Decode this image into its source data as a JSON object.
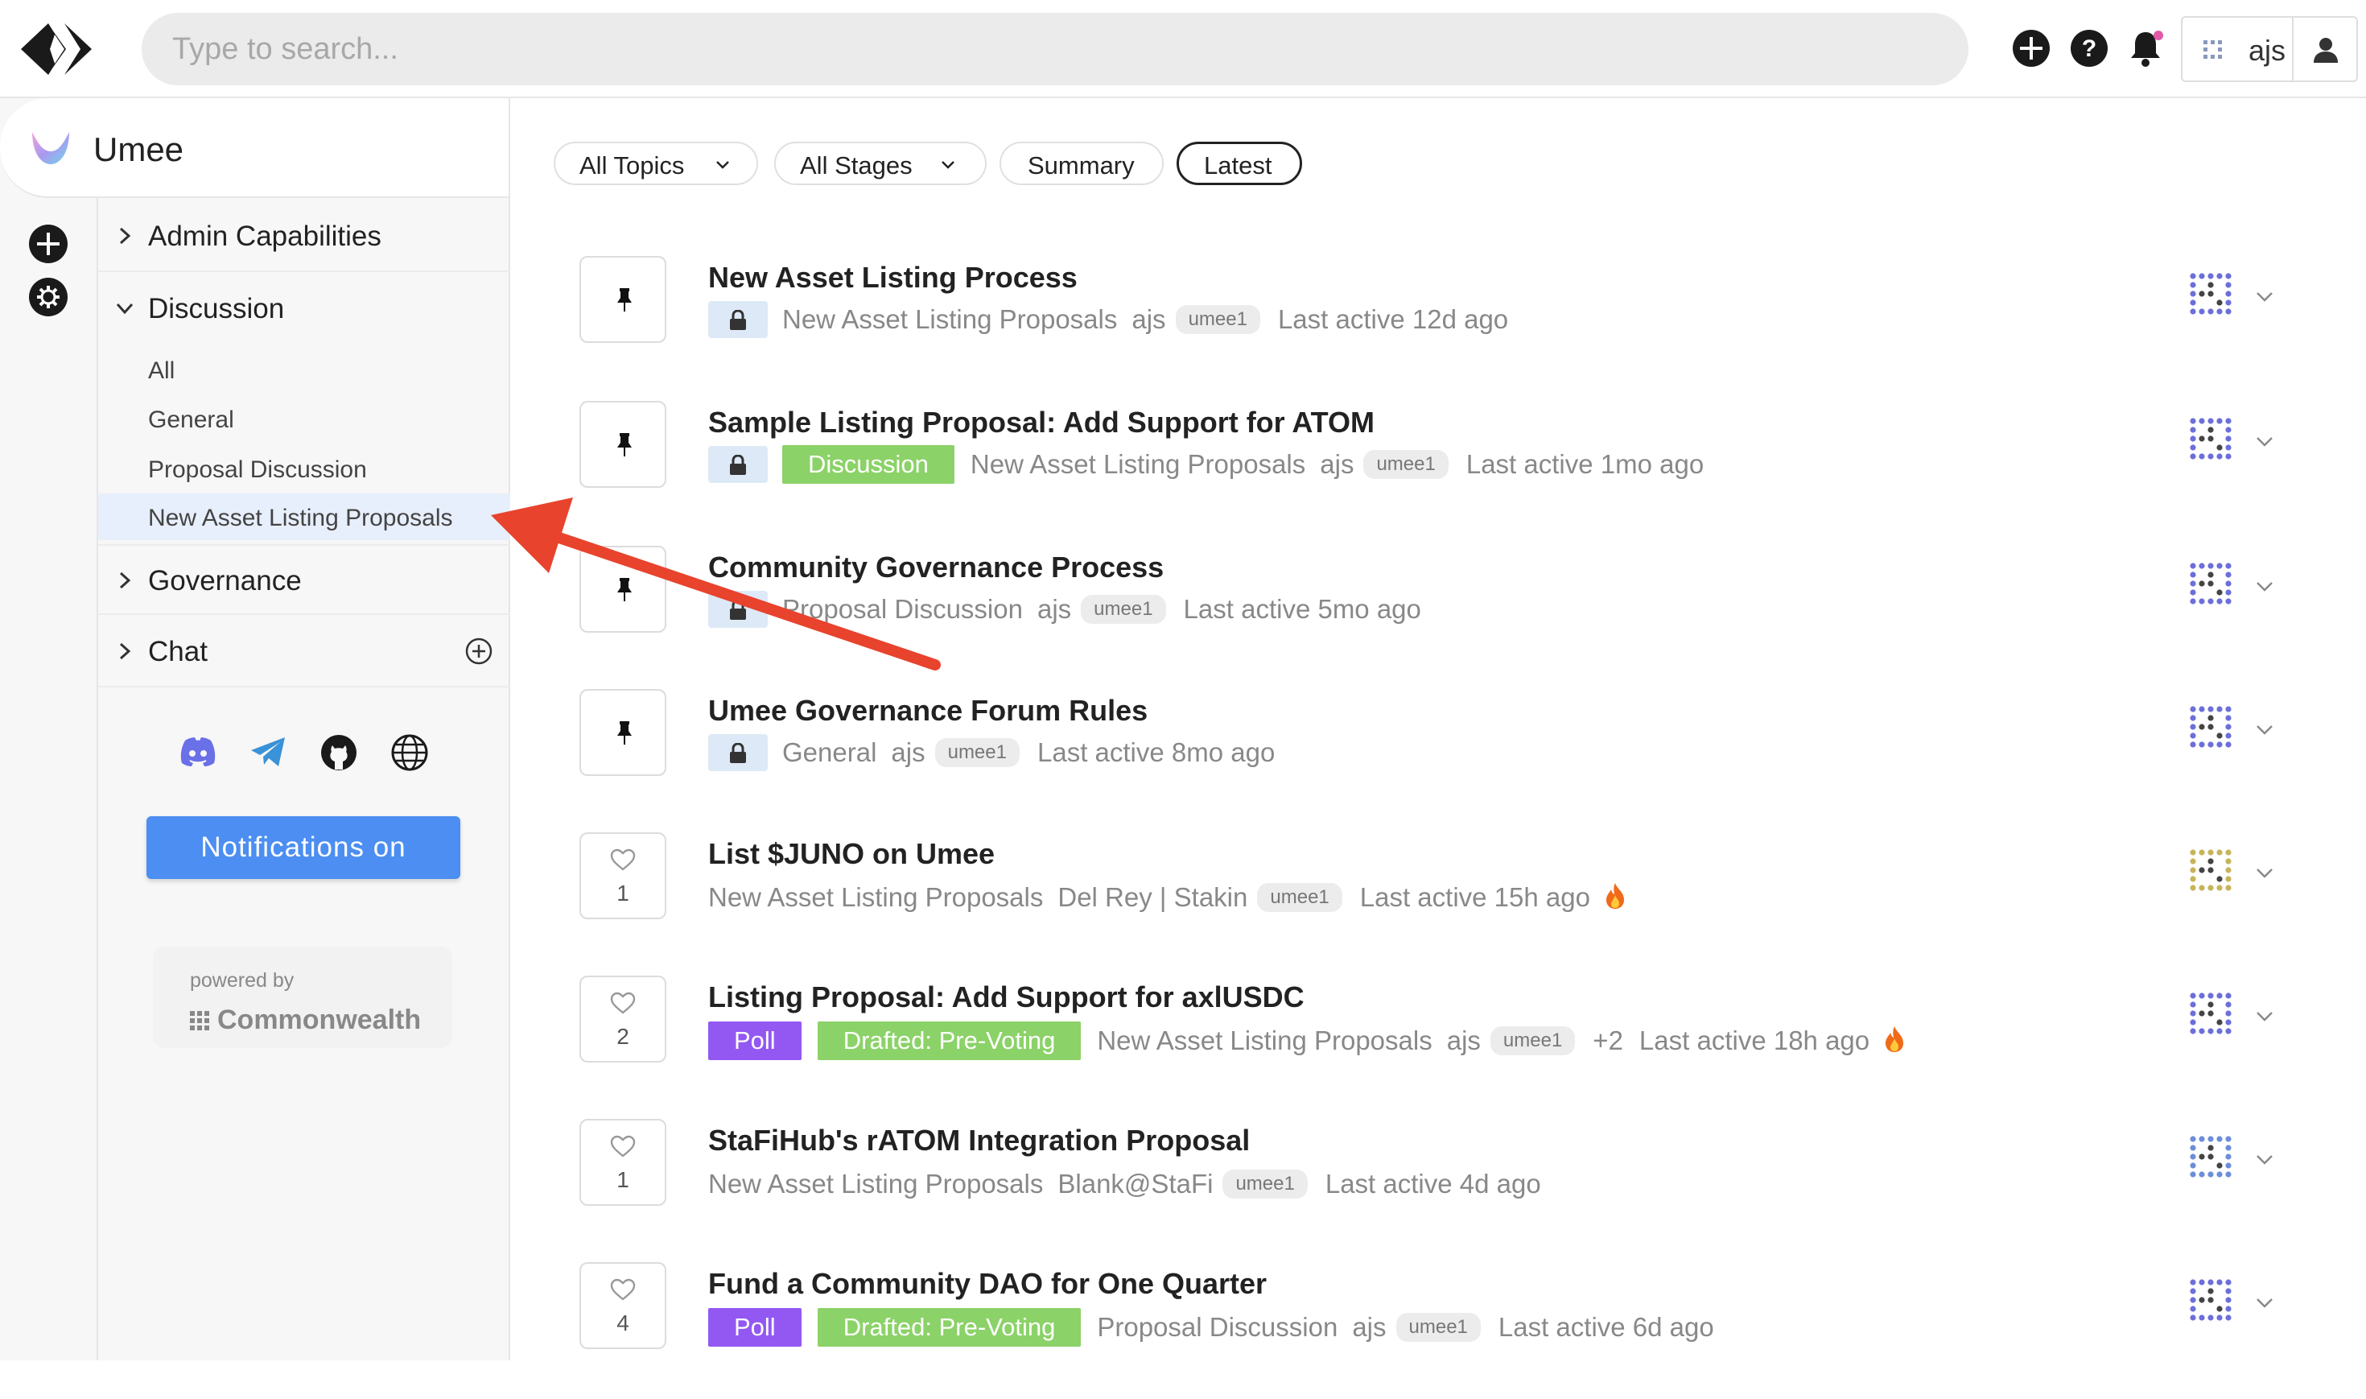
{
  "header": {
    "search_placeholder": "Type to search...",
    "username": "ajs"
  },
  "community": {
    "name": "Umee"
  },
  "sidebar": {
    "sections": [
      {
        "label": "Admin Capabilities",
        "expanded": false
      },
      {
        "label": "Discussion",
        "expanded": true
      },
      {
        "label": "Governance",
        "expanded": false
      },
      {
        "label": "Chat",
        "expanded": false
      }
    ],
    "discussion_items": [
      {
        "label": "All"
      },
      {
        "label": "General"
      },
      {
        "label": "Proposal Discussion"
      },
      {
        "label": "New Asset Listing Proposals",
        "active": true
      }
    ],
    "notifications_label": "Notifications on",
    "powered_by": "powered by",
    "brand": "Commonwealth"
  },
  "filters": {
    "topics": "All Topics",
    "stages": "All Stages",
    "summary": "Summary",
    "latest": "Latest"
  },
  "threads": [
    {
      "title": "New Asset Listing Process",
      "pinned": true,
      "locked": true,
      "tags": [],
      "topic": "New Asset Listing Proposals",
      "author": "ajs",
      "chain": "umee1",
      "extra": "",
      "last_active": "Last active 12d ago",
      "hot": false
    },
    {
      "title": "Sample Listing Proposal: Add Support for ATOM",
      "pinned": true,
      "locked": true,
      "tags": [
        {
          "label": "Discussion",
          "color": "green"
        }
      ],
      "topic": "New Asset Listing Proposals",
      "author": "ajs",
      "chain": "umee1",
      "extra": "",
      "last_active": "Last active 1mo ago",
      "hot": false
    },
    {
      "title": "Community Governance Process",
      "pinned": true,
      "locked": true,
      "tags": [],
      "topic": "Proposal Discussion",
      "author": "ajs",
      "chain": "umee1",
      "extra": "",
      "last_active": "Last active 5mo ago",
      "hot": false
    },
    {
      "title": "Umee Governance Forum Rules",
      "pinned": true,
      "locked": true,
      "tags": [],
      "topic": "General",
      "author": "ajs",
      "chain": "umee1",
      "extra": "",
      "last_active": "Last active 8mo ago",
      "hot": false
    },
    {
      "title": "List $JUNO on Umee",
      "pinned": false,
      "likes": "1",
      "locked": false,
      "tags": [],
      "topic": "New Asset Listing Proposals",
      "author": "Del Rey | Stakin",
      "chain": "umee1",
      "extra": "",
      "last_active": "Last active 15h ago",
      "hot": true
    },
    {
      "title": "Listing Proposal: Add Support for axlUSDC",
      "pinned": false,
      "likes": "2",
      "locked": false,
      "tags": [
        {
          "label": "Poll",
          "color": "purple"
        },
        {
          "label": "Drafted: Pre-Voting",
          "color": "green"
        }
      ],
      "topic": "New Asset Listing Proposals",
      "author": "ajs",
      "chain": "umee1",
      "extra": "+2",
      "last_active": "Last active 18h ago",
      "hot": true
    },
    {
      "title": "StaFiHub's rATOM Integration Proposal",
      "pinned": false,
      "likes": "1",
      "locked": false,
      "tags": [],
      "topic": "New Asset Listing Proposals",
      "author": "Blank@StaFi",
      "chain": "umee1",
      "extra": "",
      "last_active": "Last active 4d ago",
      "hot": false
    },
    {
      "title": "Fund a Community DAO for One Quarter",
      "pinned": false,
      "likes": "4",
      "locked": false,
      "tags": [
        {
          "label": "Poll",
          "color": "purple"
        },
        {
          "label": "Drafted: Pre-Voting",
          "color": "green"
        }
      ],
      "topic": "Proposal Discussion",
      "author": "ajs",
      "chain": "umee1",
      "extra": "",
      "last_active": "Last active 6d ago",
      "hot": false
    }
  ],
  "colors": {
    "accent_blue": "#4c8ef1",
    "tag_green": "#8bd268",
    "tag_purple": "#9358f2",
    "arrow_red": "#e8432d"
  },
  "icons": {
    "logo": "commonwealth-logo",
    "create": "plus-circle-icon",
    "help": "question-circle-icon",
    "notifications": "bell-icon",
    "user": "person-icon",
    "social": [
      "discord-icon",
      "telegram-icon",
      "github-icon",
      "globe-icon"
    ]
  }
}
